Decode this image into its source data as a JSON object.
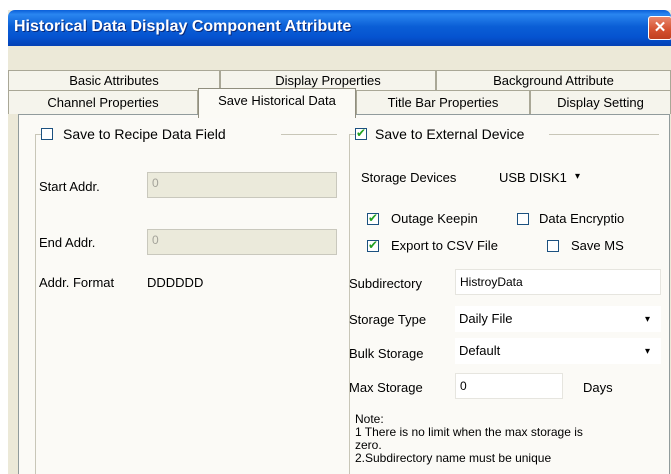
{
  "window": {
    "title": "Historical Data Display Component Attribute",
    "close_icon": "✕"
  },
  "tabs": {
    "row1": [
      "Basic Attributes",
      "Display Properties",
      "Background Attribute"
    ],
    "row2": [
      "Channel Properties",
      "Save Historical Data",
      "Title Bar Properties",
      "Display Setting"
    ],
    "active": "Save Historical Data"
  },
  "recipe": {
    "checkbox_label": "Save to Recipe Data Field",
    "checked": false,
    "start_addr_label": "Start Addr.",
    "start_addr_value": "0",
    "end_addr_label": "End Addr.",
    "end_addr_value": "0",
    "addr_format_label": "Addr. Format",
    "addr_format_value": "DDDDDD"
  },
  "external": {
    "checkbox_label": "Save to External Device",
    "checked": true,
    "storage_devices_label": "Storage Devices",
    "storage_devices_value": "USB DISK1",
    "outage_keepin_label": "Outage Keepin",
    "outage_keepin_checked": true,
    "data_encryption_label": "Data Encryptio",
    "data_encryption_checked": false,
    "export_csv_label": "Export to CSV File",
    "export_csv_checked": true,
    "save_ms_label": "Save MS",
    "save_ms_checked": false,
    "subdirectory_label": "Subdirectory",
    "subdirectory_value": "HistroyData",
    "storage_type_label": "Storage Type",
    "storage_type_value": "Daily File",
    "bulk_storage_label": "Bulk Storage",
    "bulk_storage_value": "Default",
    "max_storage_label": "Max Storage",
    "max_storage_value": "0",
    "max_storage_unit": "Days",
    "note_title": "Note:",
    "note_line1": "1 There is no limit when the max storage is",
    "note_line1b": "zero.",
    "note_line2": "2.Subdirectory name must be unique"
  },
  "icons": {
    "dropdown": "▾",
    "check": "✔"
  }
}
